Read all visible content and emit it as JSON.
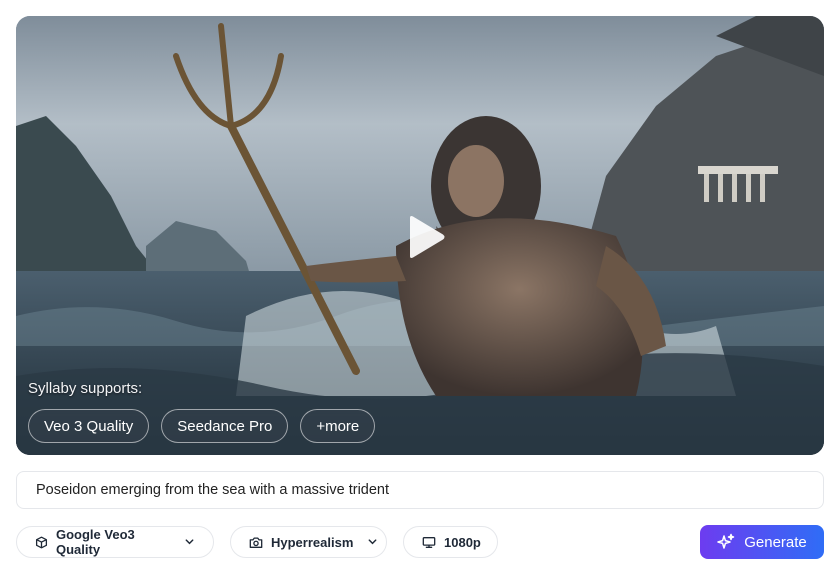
{
  "video": {
    "supports_label": "Syllaby supports:",
    "models": [
      "Veo 3 Quality",
      "Seedance Pro",
      "+more"
    ],
    "play_icon": "play-icon"
  },
  "prompt": {
    "value": "Poseidon emerging from the sea with a massive trident"
  },
  "options": {
    "model": {
      "label": "Google Veo3 Quality",
      "icon": "cube-icon"
    },
    "style": {
      "label": "Hyperrealism",
      "icon": "camera-icon"
    },
    "resolution": {
      "label": "1080p",
      "icon": "monitor-icon"
    }
  },
  "generate": {
    "label": "Generate",
    "icon": "sparkle-icon"
  },
  "colors": {
    "accent_start": "#6d3cf0",
    "accent_end": "#2f6df6"
  }
}
